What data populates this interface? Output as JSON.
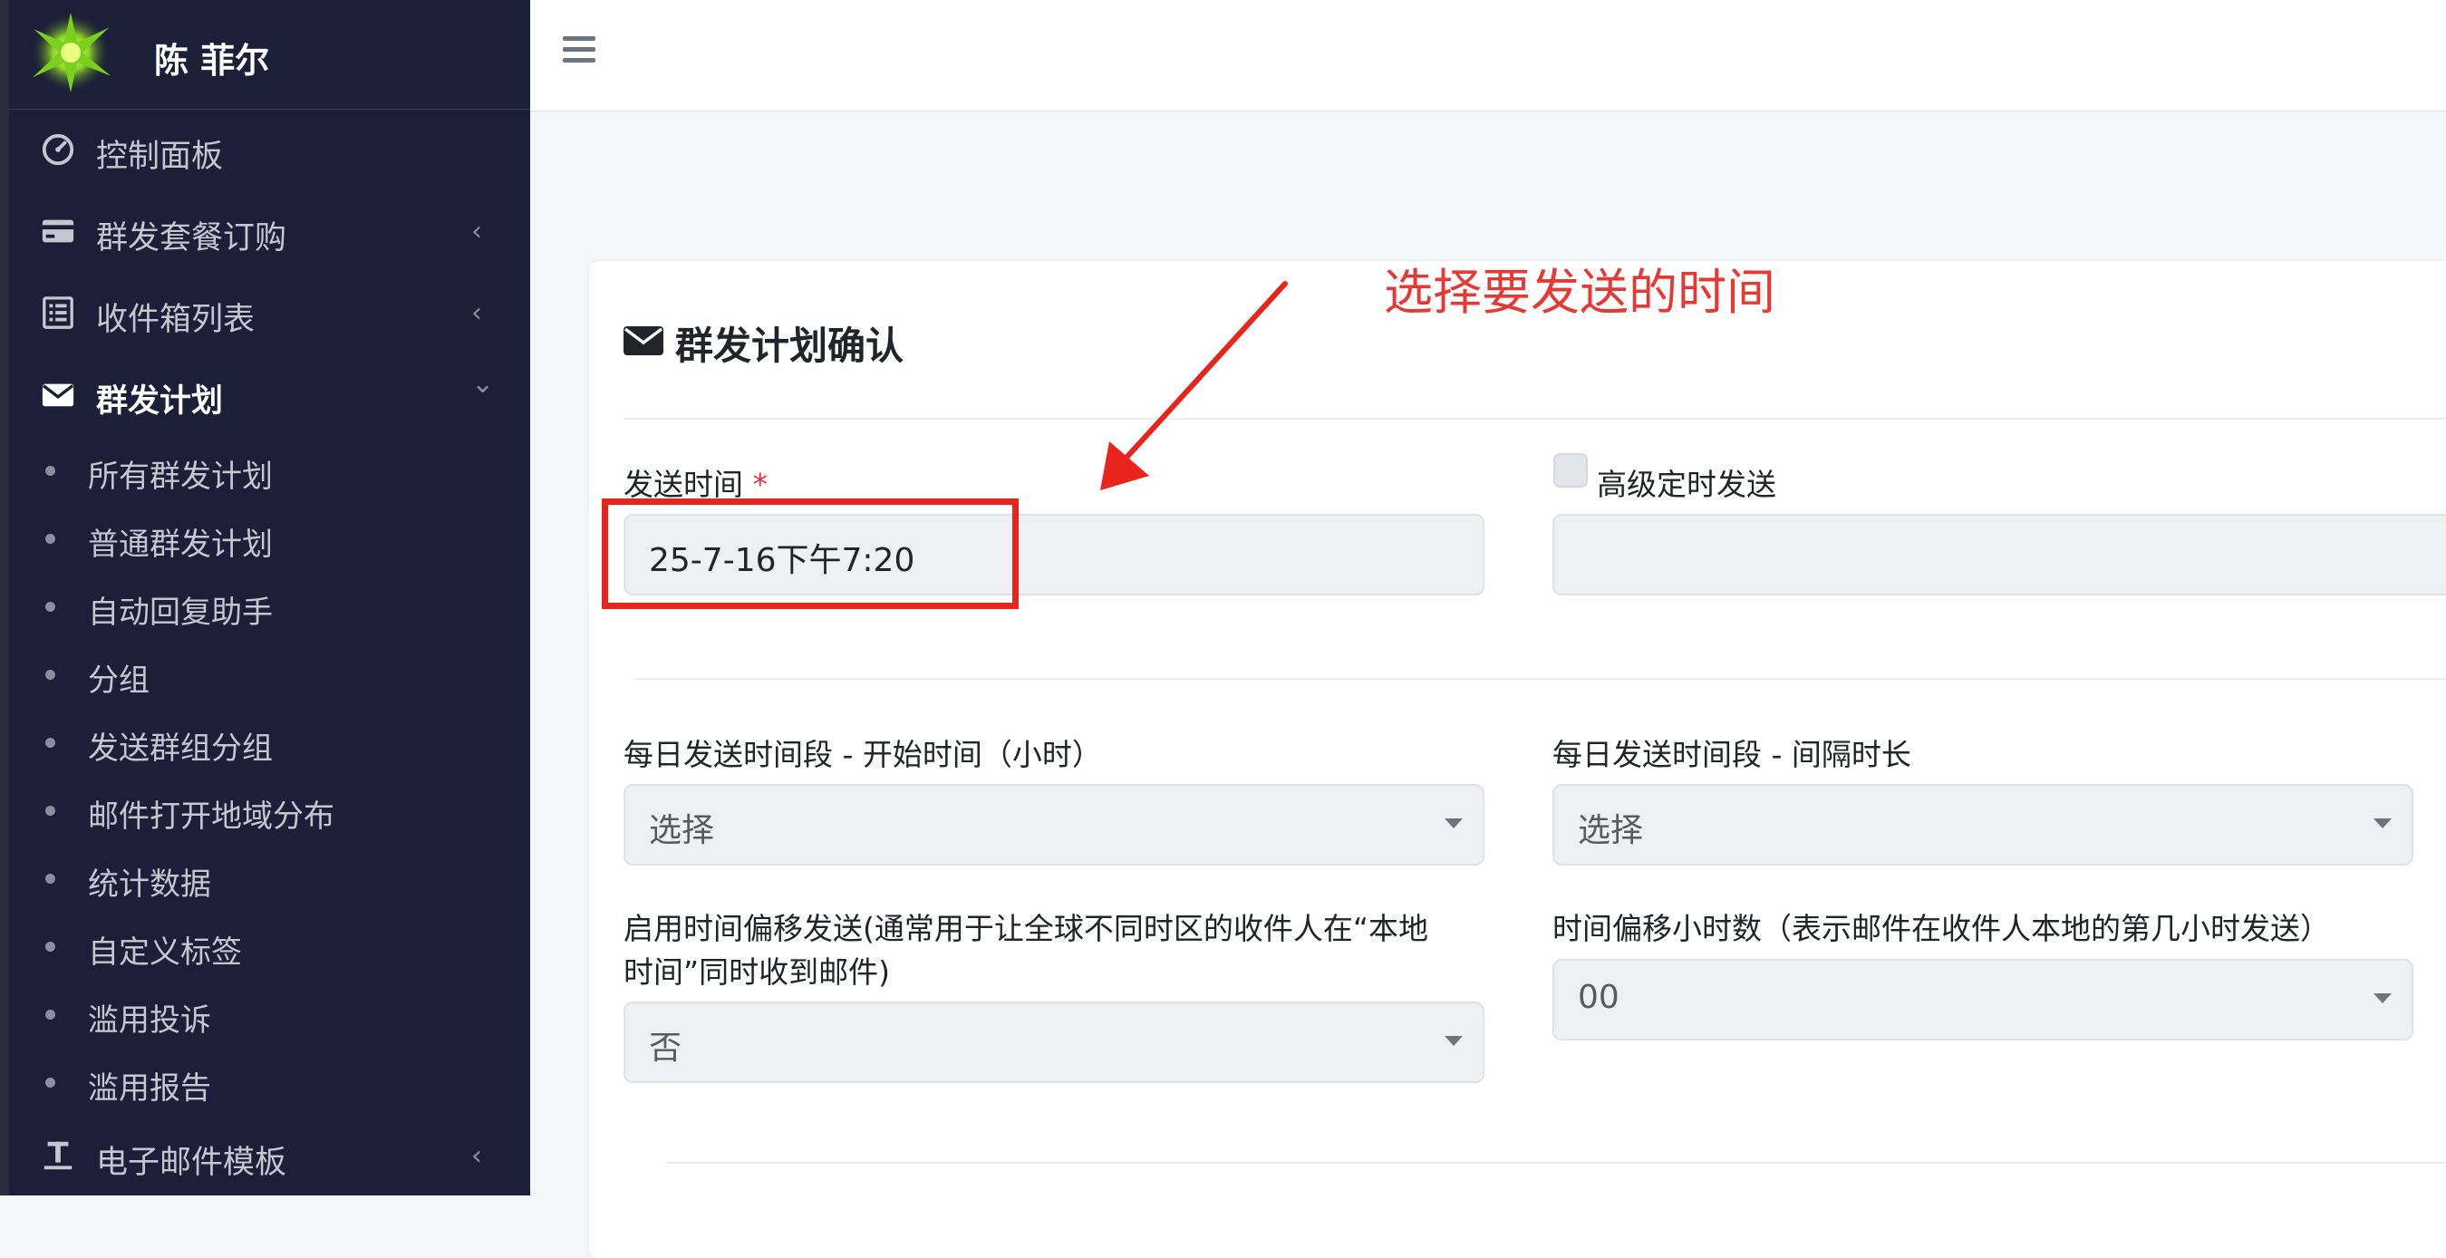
{
  "sidebar": {
    "user_name": "陈 菲尔",
    "nav": [
      {
        "label": "控制面板",
        "icon": "dashboard-gauge-icon",
        "arrow": ""
      },
      {
        "label": "群发套餐订购",
        "icon": "credit-card-icon",
        "arrow": "‹"
      },
      {
        "label": "收件箱列表",
        "icon": "list-icon",
        "arrow": "‹"
      },
      {
        "label": "群发计划",
        "icon": "envelope-icon",
        "arrow": "⌄",
        "active": true
      },
      {
        "label": "电子邮件模板",
        "icon": "text-format-icon",
        "arrow": "‹"
      }
    ],
    "sub_items": [
      {
        "label": "所有群发计划"
      },
      {
        "label": "普通群发计划"
      },
      {
        "label": "自动回复助手"
      },
      {
        "label": "分组"
      },
      {
        "label": "发送群组分组"
      },
      {
        "label": "邮件打开地域分布"
      },
      {
        "label": "统计数据"
      },
      {
        "label": "自定义标签"
      },
      {
        "label": "滥用投诉"
      },
      {
        "label": "滥用报告"
      }
    ]
  },
  "card": {
    "title": "群发计划确认",
    "send_time": {
      "label": "发送时间",
      "required_mark": "*",
      "value": "25-7-16下午7:20"
    },
    "advanced": {
      "label": "高级定时发送",
      "checked": false,
      "value": ""
    },
    "daily_start": {
      "label": "每日发送时间段 - 开始时间（小时）",
      "value": "选择"
    },
    "daily_interval": {
      "label": "每日发送时间段 - 间隔时长",
      "value": "选择"
    },
    "offset_enable": {
      "label_line1": "启用时间偏移发送(通常用于让全球不同时区的收件人在“本地",
      "label_line2": "时间”同时收到邮件)",
      "value": "否"
    },
    "offset_hours": {
      "label": "时间偏移小时数（表示邮件在收件人本地的第几小时发送）",
      "value": "00"
    }
  },
  "annotation": {
    "text": "选择要发送的时间",
    "color": "#e53935"
  },
  "colors": {
    "sidebar_bg": "#1c1f38",
    "accent_red": "#e8241c",
    "field_bg": "#eef0f3"
  }
}
